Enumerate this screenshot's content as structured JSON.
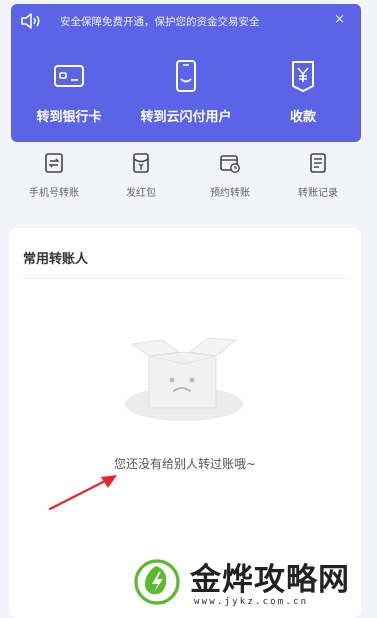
{
  "notice": {
    "text": "安全保障免费开通，保护您的资金交易安全",
    "close": "×",
    "icon": "speaker-icon"
  },
  "actions": [
    {
      "label": "转到银行卡",
      "icon": "bank-card-icon"
    },
    {
      "label": "转到云闪付用户",
      "icon": "phone-user-icon"
    },
    {
      "label": "收款",
      "icon": "yuan-receive-icon"
    }
  ],
  "quick": [
    {
      "label": "手机号转账",
      "icon": "phone-transfer-icon"
    },
    {
      "label": "发红包",
      "icon": "red-packet-icon"
    },
    {
      "label": "预约转账",
      "icon": "calendar-clock-icon"
    },
    {
      "label": "转账记录",
      "icon": "document-icon"
    }
  ],
  "frequent": {
    "title": "常用转账人",
    "empty_text": "您还没有给别人转过账哦~"
  },
  "watermark": {
    "title": "金烨攻略网",
    "url": "www.jykz.com.cn"
  },
  "colors": {
    "primary": "#5b64e6",
    "arrow": "#e0262e",
    "watermark_green": "#5db833"
  }
}
